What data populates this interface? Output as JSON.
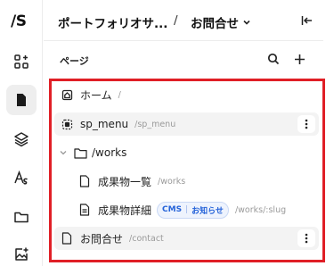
{
  "app": {
    "logo_text": "/S"
  },
  "rail": {
    "items": [
      {
        "icon": "add-widget-icon"
      },
      {
        "icon": "page-icon",
        "active": true
      },
      {
        "icon": "layers-icon"
      },
      {
        "icon": "font-icon"
      },
      {
        "icon": "folder-icon"
      },
      {
        "icon": "add-image-icon"
      }
    ]
  },
  "header": {
    "breadcrumb_root": "ポートフォリオサ...",
    "separator": "/",
    "current": "お問合せ"
  },
  "section": {
    "title": "ページ"
  },
  "tree": [
    {
      "label": "ホーム",
      "path": "/"
    },
    {
      "label": "sp_menu",
      "path": "/sp_menu"
    },
    {
      "label": "/works",
      "path": ""
    },
    {
      "label": "成果物一覧",
      "path": "/works"
    },
    {
      "label": "成果物詳細",
      "path": "/works/:slug",
      "badge_cms": "CMS",
      "badge_source": "お知らせ"
    },
    {
      "label": "お問合せ",
      "path": "/contact"
    }
  ],
  "colors": {
    "highlight": "#e01f26",
    "badge_text": "#2563d9"
  }
}
